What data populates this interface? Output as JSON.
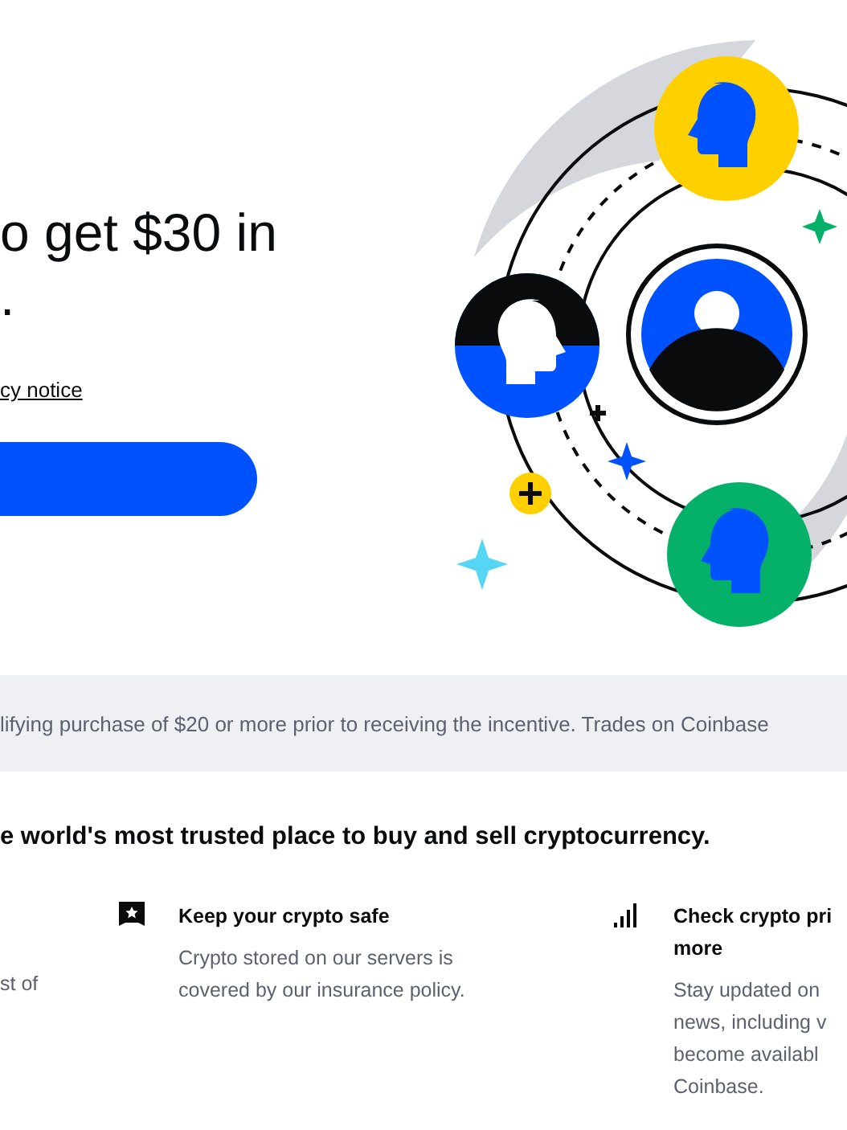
{
  "hero": {
    "title_lines": [
      "o get $30 in",
      "."
    ],
    "privacy_link": "cy notice",
    "button": {
      "kind": "primary"
    }
  },
  "disclaimer": "lifying purchase of $20 or more prior to receiving the incentive. Trades on Coinbase",
  "section_heading": "e world's most trusted place to buy and sell cryptocurrency.",
  "features": [
    {
      "kind": "partial",
      "description_lines": [
        "st of"
      ]
    },
    {
      "kind": "safe",
      "title_lines": [
        "Keep your crypto safe"
      ],
      "description_lines": [
        "Crypto stored on our servers is",
        "covered by our insurance policy."
      ]
    },
    {
      "kind": "prices",
      "title_lines": [
        "Check crypto pri",
        "more"
      ],
      "description_lines": [
        "Stay updated on",
        "news, including v",
        "become availabl",
        "Coinbase."
      ]
    }
  ]
}
